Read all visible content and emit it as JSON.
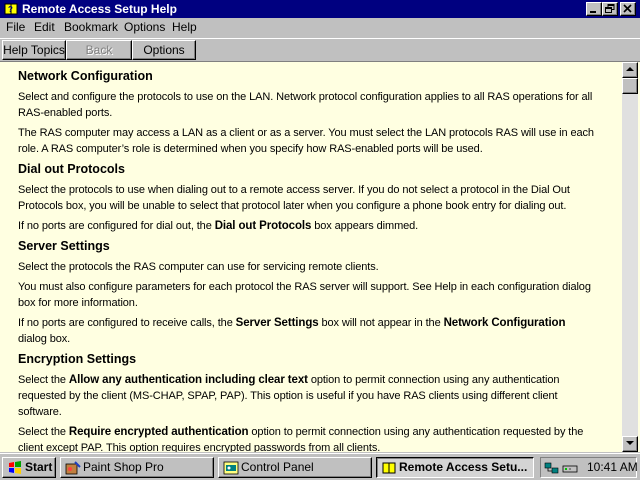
{
  "window": {
    "title": "Remote Access Setup Help",
    "colors": {
      "titlebar": "#000080",
      "content_bg": "#ffffe1",
      "chrome": "#c0c0c0"
    }
  },
  "menubar": {
    "items": [
      "File",
      "Edit",
      "Bookmark",
      "Options",
      "Help"
    ]
  },
  "buttonbar": {
    "help_topics": "Help Topics",
    "back": "Back",
    "options": "Options"
  },
  "content": {
    "s1_title": "Network Configuration",
    "s1_p1": "Select and configure the protocols to use on the LAN. Network protocol configuration applies to all RAS operations for all RAS-enabled ports.",
    "s1_p2": "The RAS computer may access a LAN as a client or as a server. You must select the LAN protocols RAS will use in each role. A RAS computer’s role is determined when you specify how RAS-enabled ports will be used.",
    "s2_title": "Dial out Protocols",
    "s2_p1": "Select the protocols to use when dialing out to a remote access server. If you do not select a protocol in the Dial Out Protocols box, you will be unable to select that protocol later when you configure a phone book entry for dialing out.",
    "s2_p2_a": "If no ports are configured for dial out, the ",
    "s2_p2_b": "Dial out Protocols",
    "s2_p2_c": " box appears dimmed.",
    "s3_title": "Server Settings",
    "s3_p1": "Select the protocols the RAS computer can use for servicing remote clients.",
    "s3_p2": "You must also configure parameters for each protocol the RAS server will support. See Help in each configuration dialog box for more information.",
    "s3_p3_a": "If no ports are configured to receive calls, the ",
    "s3_p3_b": "Server Settings",
    "s3_p3_c": " box will not appear in the ",
    "s3_p3_d": "Network Configuration",
    "s3_p3_e": " dialog box.",
    "s4_title": "Encryption Settings",
    "s4_p1_a": "Select the ",
    "s4_p1_b": "Allow any authentication including clear text",
    "s4_p1_c": " option to permit connection using any authentication requested by the client (MS-CHAP, SPAP, PAP). This option is useful if you have RAS clients using different client software.",
    "s4_p2_a": "Select the ",
    "s4_p2_b": "Require encrypted authentication",
    "s4_p2_c": " option to permit connection using any authentication requested by the client except PAP. This option requires encrypted passwords from all clients."
  },
  "taskbar": {
    "start": "Start",
    "tasks": [
      "Paint Shop Pro",
      "Control Panel",
      "Remote Access Setu..."
    ],
    "clock": "10:41 AM"
  }
}
